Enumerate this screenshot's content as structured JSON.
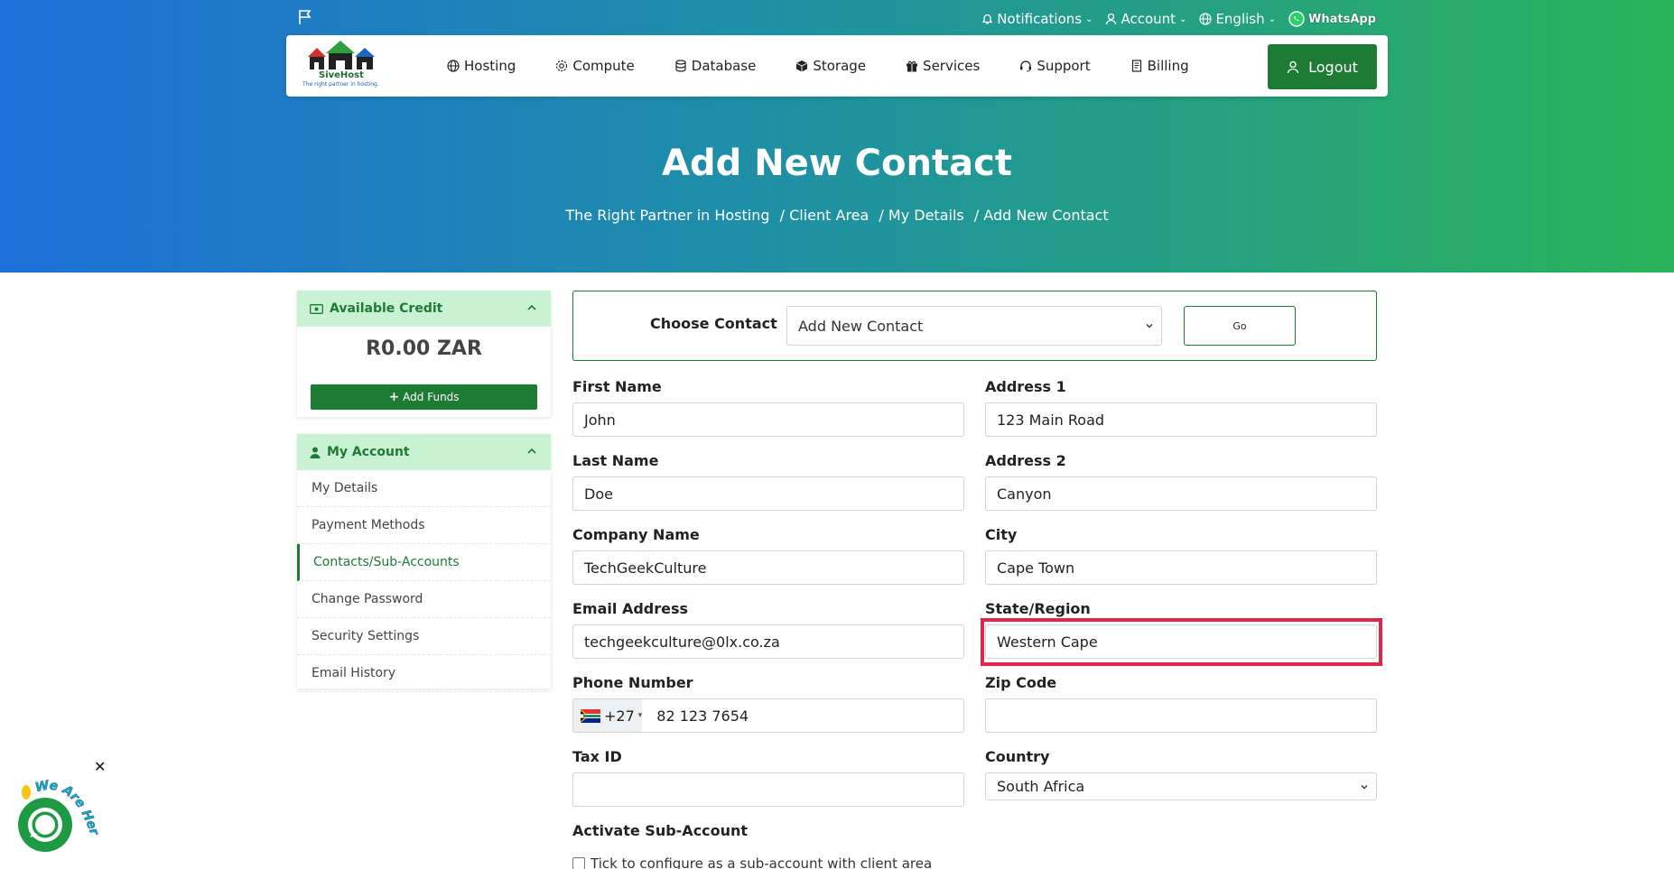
{
  "topbar": {
    "notifications": "Notifications",
    "account": "Account",
    "language": "English",
    "whatsapp": "WhatsApp"
  },
  "logo": {
    "brand": "SiveHost",
    "tagline": "The right partner in hosting."
  },
  "nav": {
    "items": [
      {
        "label": "Hosting",
        "icon": "globe-icon"
      },
      {
        "label": "Compute",
        "icon": "gear-icon"
      },
      {
        "label": "Database",
        "icon": "database-icon"
      },
      {
        "label": "Storage",
        "icon": "box-icon"
      },
      {
        "label": "Services",
        "icon": "gift-icon"
      },
      {
        "label": "Support",
        "icon": "headset-icon"
      },
      {
        "label": "Billing",
        "icon": "document-icon"
      }
    ],
    "logout": "Logout"
  },
  "page": {
    "title": "Add New Contact",
    "breadcrumb": [
      "The Right Partner in Hosting",
      "/ Client Area",
      "/ My Details",
      "/ Add New Contact"
    ]
  },
  "sidebar": {
    "credit": {
      "title": "Available Credit",
      "amount": "R0.00 ZAR",
      "add_funds": "Add Funds"
    },
    "account": {
      "title": "My Account",
      "items": [
        "My Details",
        "Payment Methods",
        "Contacts/Sub-Accounts",
        "Change Password",
        "Security Settings",
        "Email History"
      ],
      "active_index": 2
    }
  },
  "form": {
    "choose_label": "Choose Contact",
    "choose_value": "Add New Contact",
    "go": "Go",
    "first_name": {
      "label": "First Name",
      "value": "John"
    },
    "last_name": {
      "label": "Last Name",
      "value": "Doe"
    },
    "company": {
      "label": "Company Name",
      "value": "TechGeekCulture"
    },
    "email": {
      "label": "Email Address",
      "value": "techgeekculture@0lx.co.za"
    },
    "phone": {
      "label": "Phone Number",
      "country_code": "+27",
      "value": "82 123 7654"
    },
    "tax_id": {
      "label": "Tax ID",
      "value": ""
    },
    "address1": {
      "label": "Address 1",
      "value": "123 Main Road"
    },
    "address2": {
      "label": "Address 2",
      "value": "Canyon"
    },
    "city": {
      "label": "City",
      "value": "Cape Town"
    },
    "state": {
      "label": "State/Region",
      "value": "Western Cape"
    },
    "zip": {
      "label": "Zip Code",
      "value": ""
    },
    "country": {
      "label": "Country",
      "value": "South Africa"
    },
    "subaccount": {
      "label": "Activate Sub-Account",
      "checkbox_label": "Tick to configure as a sub-account with client area"
    }
  },
  "chat": {
    "badge": "We Are Here!"
  },
  "colors": {
    "brand_green": "#1e7b34",
    "highlight": "#e0264b",
    "panel_head": "#c9f1d3"
  }
}
